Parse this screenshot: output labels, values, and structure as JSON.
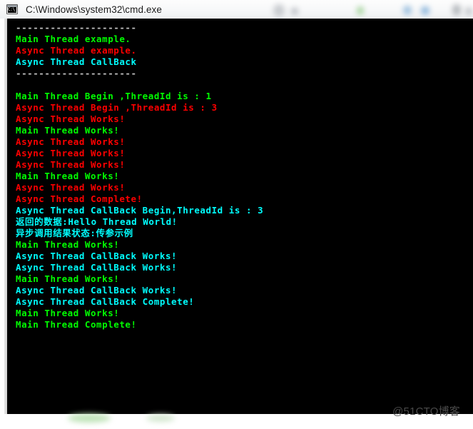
{
  "window": {
    "title": "C:\\Windows\\system32\\cmd.exe",
    "icon": "cmd-console-icon"
  },
  "console": {
    "background_color": "#000000",
    "colors": {
      "green": "#00ff00",
      "red": "#ff0000",
      "cyan": "#00ffff",
      "silver": "#c0c0c0"
    },
    "lines": [
      {
        "text": "---------------------",
        "color": "#c0c0c0"
      },
      {
        "text": "Main Thread example.",
        "color": "#00ff00"
      },
      {
        "text": "Async Thread example.",
        "color": "#ff0000"
      },
      {
        "text": "Async Thread CallBack",
        "color": "#00ffff"
      },
      {
        "text": "---------------------",
        "color": "#c0c0c0"
      },
      {
        "text": "",
        "color": "#c0c0c0"
      },
      {
        "text": "Main Thread Begin ,ThreadId is : 1",
        "color": "#00ff00"
      },
      {
        "text": "Async Thread Begin ,ThreadId is : 3",
        "color": "#ff0000"
      },
      {
        "text": "Async Thread Works!",
        "color": "#ff0000"
      },
      {
        "text": "Main Thread Works!",
        "color": "#00ff00"
      },
      {
        "text": "Async Thread Works!",
        "color": "#ff0000"
      },
      {
        "text": "Async Thread Works!",
        "color": "#ff0000"
      },
      {
        "text": "Async Thread Works!",
        "color": "#ff0000"
      },
      {
        "text": "Main Thread Works!",
        "color": "#00ff00"
      },
      {
        "text": "Async Thread Works!",
        "color": "#ff0000"
      },
      {
        "text": "Async Thread Complete!",
        "color": "#ff0000"
      },
      {
        "text": "Async Thread CallBack Begin,ThreadId is : 3",
        "color": "#00ffff"
      },
      {
        "text": "返回的数据:Hello Thread World!",
        "color": "#00ffff"
      },
      {
        "text": "异步调用结果状态:传参示例",
        "color": "#00ffff"
      },
      {
        "text": "Main Thread Works!",
        "color": "#00ff00"
      },
      {
        "text": "Async Thread CallBack Works!",
        "color": "#00ffff"
      },
      {
        "text": "Async Thread CallBack Works!",
        "color": "#00ffff"
      },
      {
        "text": "Main Thread Works!",
        "color": "#00ff00"
      },
      {
        "text": "Async Thread CallBack Works!",
        "color": "#00ffff"
      },
      {
        "text": "Async Thread CallBack Complete!",
        "color": "#00ffff"
      },
      {
        "text": "Main Thread Works!",
        "color": "#00ff00"
      },
      {
        "text": "Main Thread Complete!",
        "color": "#00ff00"
      }
    ]
  },
  "watermark": {
    "text": "@51CTO博客"
  }
}
